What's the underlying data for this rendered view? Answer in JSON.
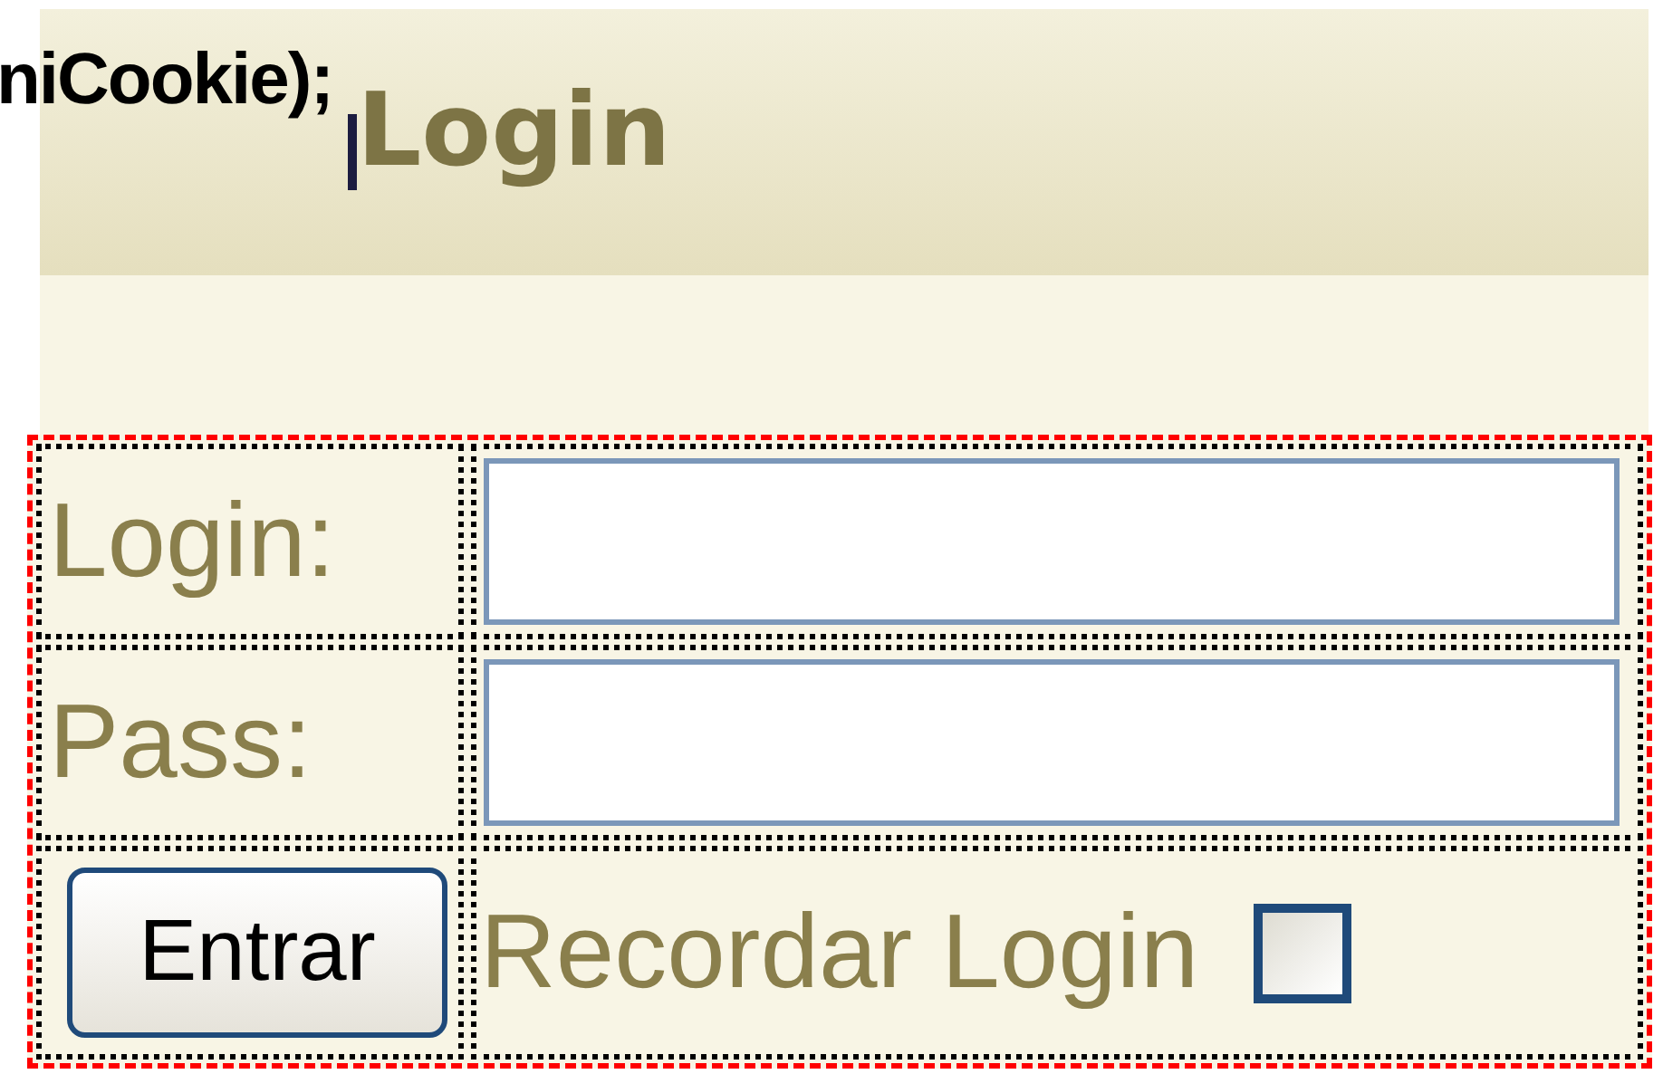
{
  "code_fragment": "niCookie);",
  "header": {
    "title": "Login"
  },
  "form": {
    "fields": [
      {
        "label": "Login:"
      },
      {
        "label": "Pass:"
      }
    ],
    "submit": "Entrar",
    "remember": {
      "label": "Recordar Login",
      "checked": false
    }
  }
}
